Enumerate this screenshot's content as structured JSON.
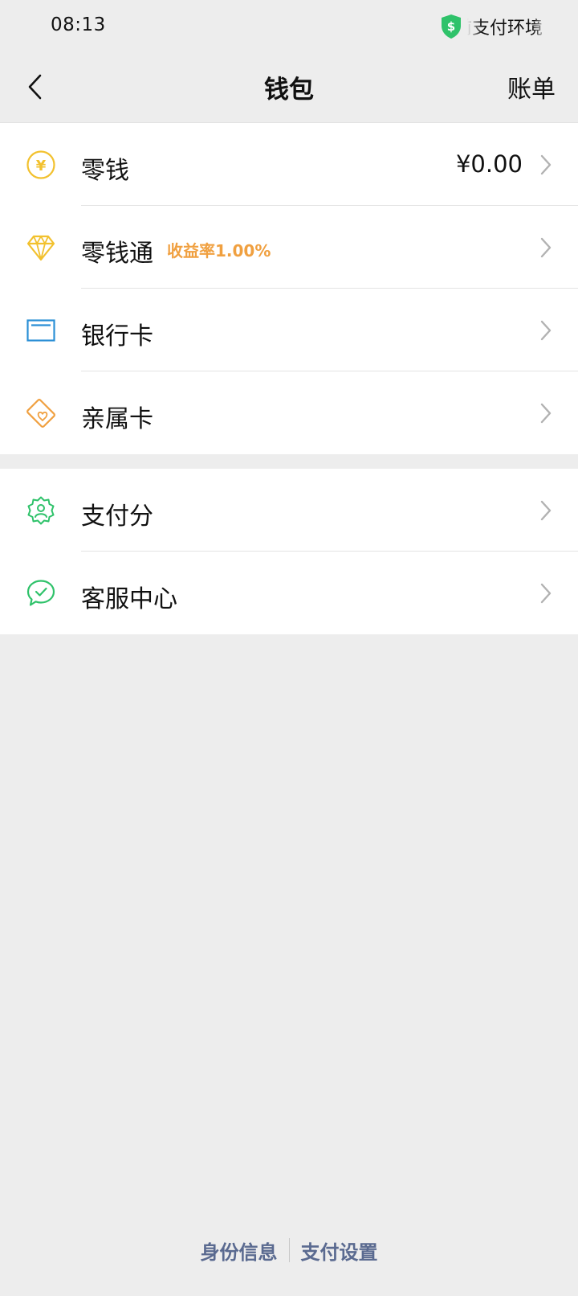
{
  "status_bar": {
    "time": "08:13",
    "security_text": "前支付环境",
    "shield_icon": "shield-dollar-icon",
    "shield_color": "#2fc26a"
  },
  "nav": {
    "back_icon": "chevron-left-icon",
    "title": "钱包",
    "bill_label": "账单"
  },
  "groups": [
    {
      "items": [
        {
          "icon": "yuan-coin-icon",
          "icon_color": "#f2c12e",
          "label": "零钱",
          "value": "¥0.00"
        },
        {
          "icon": "diamond-icon",
          "icon_color": "#f2c12e",
          "label": "零钱通",
          "badge": "收益率1.00%",
          "badge_color": "#f0a040"
        },
        {
          "icon": "bank-card-icon",
          "icon_color": "#2b8fd6",
          "label": "银行卡"
        },
        {
          "icon": "family-card-icon",
          "icon_color": "#f0a040",
          "label": "亲属卡"
        }
      ]
    },
    {
      "items": [
        {
          "icon": "pay-score-icon",
          "icon_color": "#2fc26a",
          "label": "支付分"
        },
        {
          "icon": "customer-service-icon",
          "icon_color": "#2fc26a",
          "label": "客服中心"
        }
      ]
    }
  ],
  "footer": {
    "identity_label": "身份信息",
    "settings_label": "支付设置",
    "link_color": "#5a6a90"
  }
}
